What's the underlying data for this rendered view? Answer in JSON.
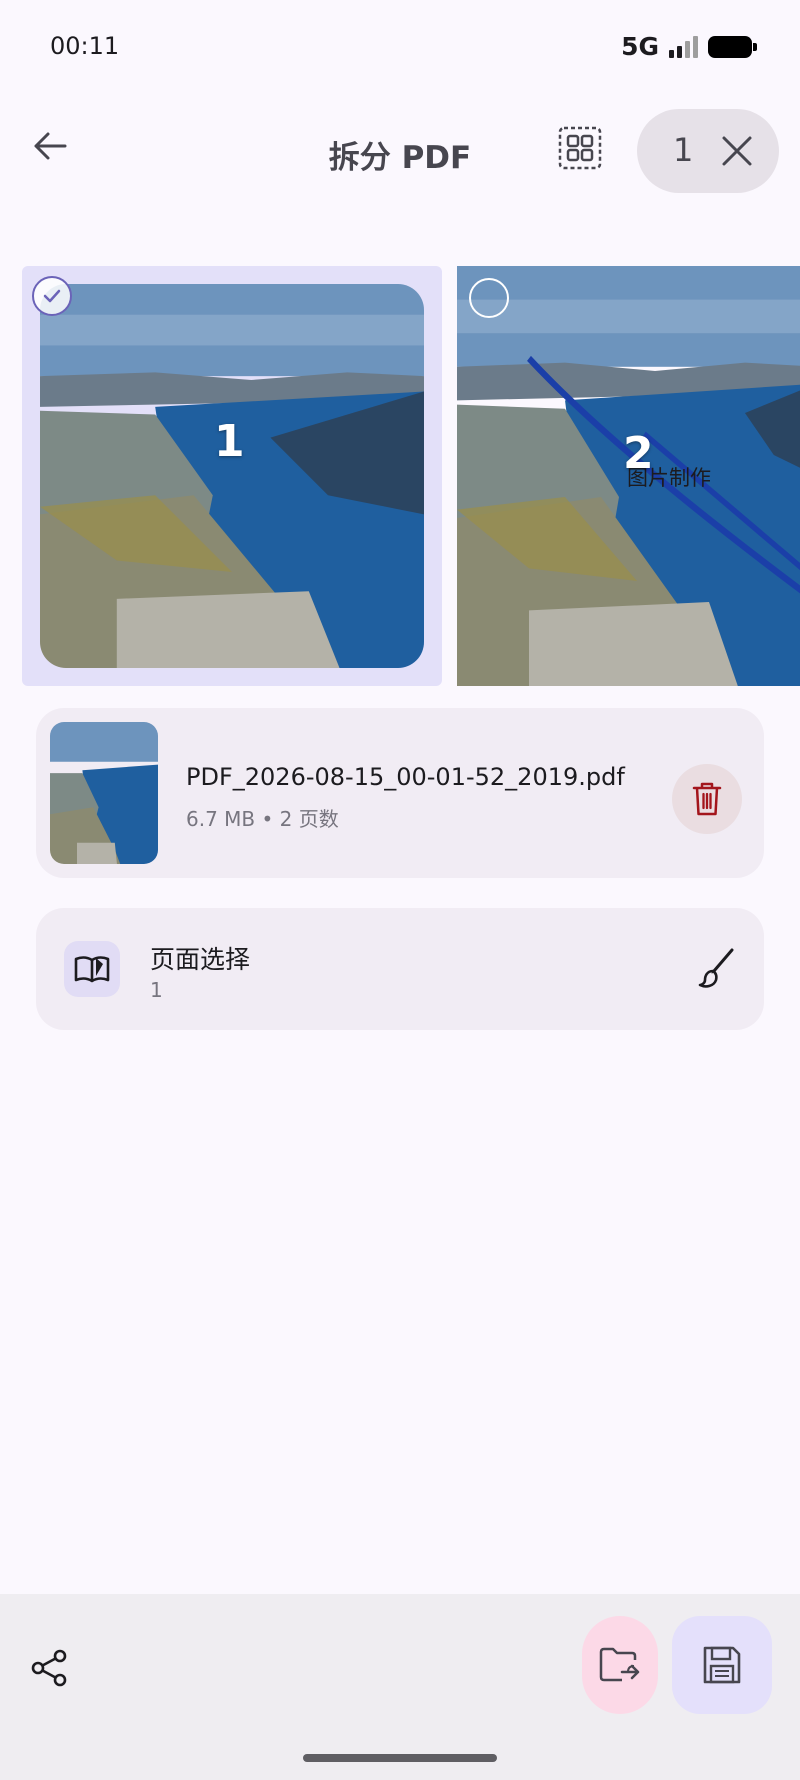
{
  "status_bar": {
    "time": "00:11",
    "network": "5G",
    "signal_level": 0.5,
    "battery": "full"
  },
  "header": {
    "title": "拆分 PDF",
    "selected_count": "1",
    "icons": {
      "back": "arrow-back-icon",
      "grid": "select-grid-icon",
      "close": "close-icon"
    }
  },
  "pages": [
    {
      "number": "1",
      "selected": true
    },
    {
      "number": "2",
      "selected": false,
      "overlay_text": "图片制作"
    }
  ],
  "file": {
    "name": "PDF_2026-08-15_00-01-52_2019.pdf",
    "meta": "6.7 MB • 2 页数",
    "delete_icon": "trash-icon"
  },
  "page_selection": {
    "label": "页面选择",
    "value": "1",
    "icon": "open-book-icon",
    "edit_icon": "brush-icon"
  },
  "bottom_bar": {
    "share_icon": "share-icon",
    "move_icon": "folder-move-icon",
    "save_icon": "save-icon"
  },
  "colors": {
    "background": "#fbf8fe",
    "card": "#f1ecf4",
    "selected_page": "#e3e0f9",
    "delete_accent": "#a3151c",
    "move_button": "#fcd9e7",
    "save_button": "#e4e0fb"
  }
}
